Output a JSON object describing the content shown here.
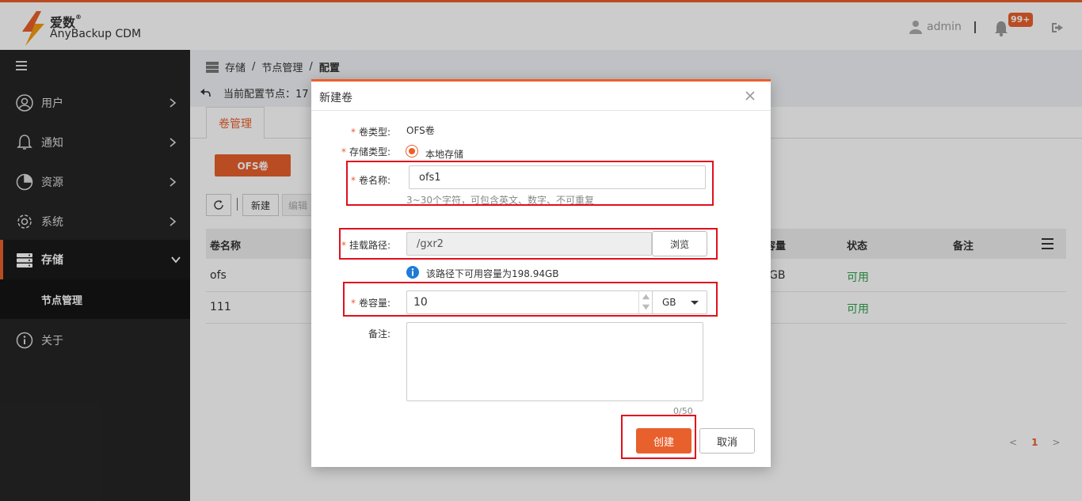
{
  "app": {
    "brand_cn": "爱数",
    "brand_reg": "®",
    "brand_en": "AnyBackup CDM",
    "accent": "#e8602c"
  },
  "header": {
    "user": "admin",
    "badge": "99+"
  },
  "sidebar": {
    "items": [
      {
        "label": "用户"
      },
      {
        "label": "通知"
      },
      {
        "label": "资源"
      },
      {
        "label": "系统"
      },
      {
        "label": "存储"
      },
      {
        "label": "关于"
      }
    ],
    "sub_item": "节点管理"
  },
  "breadcrumb": {
    "level1": "存储",
    "sep": "/",
    "level2": "节点管理",
    "level3": "配置"
  },
  "node_label": "当前配置节点：17",
  "tab": "卷管理",
  "ofs_button": "OFS卷",
  "toolbar": {
    "new": "新建",
    "edit": "编辑"
  },
  "table": {
    "headers": {
      "name": "卷名称",
      "capacity": "容量",
      "status": "状态",
      "remark": "备注"
    },
    "rows": [
      {
        "name": "ofs",
        "capacity": "GB",
        "status": "可用"
      },
      {
        "name": "111",
        "capacity": "",
        "status": "可用"
      }
    ]
  },
  "pager": {
    "prev": "<",
    "page": "1",
    "next": ">"
  },
  "modal": {
    "title": "新建卷",
    "type_label": "卷类型:",
    "type_value": "OFS卷",
    "storage_label": "存储类型:",
    "storage_value": "本地存储",
    "name_label": "卷名称:",
    "name_value": "ofs1",
    "name_hint": "3~30个字符，可包含英文、数字、不可重复",
    "path_label": "挂载路径:",
    "path_value": "/gxr2",
    "browse": "浏览",
    "path_info": "该路径下可用容量为198.94GB",
    "capacity_label": "卷容量:",
    "capacity_value": "10",
    "unit": "GB",
    "remark_label": "备注:",
    "remark_counter": "0/50",
    "create": "创建",
    "cancel": "取消"
  }
}
